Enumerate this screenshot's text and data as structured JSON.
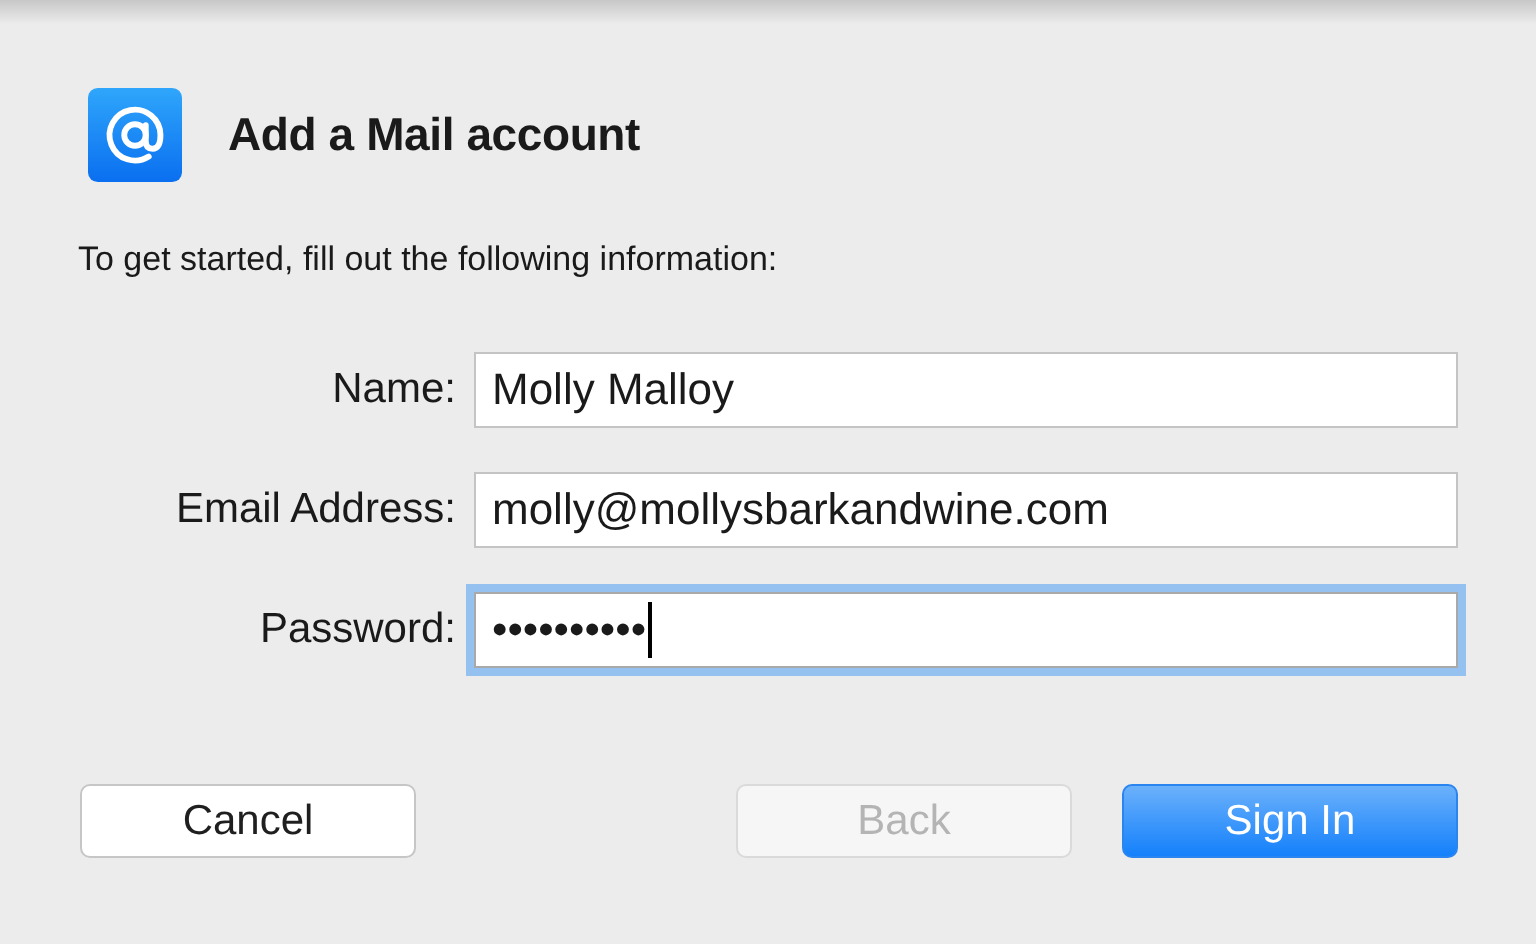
{
  "title": "Add a Mail account",
  "instructions": "To get started, fill out the following information:",
  "fields": [
    {
      "label": "Name:",
      "value": "Molly Malloy",
      "focused": false
    },
    {
      "label": "Email Address:",
      "value": "molly@mollysbarkandwine.com",
      "focused": false
    },
    {
      "label": "Password:",
      "value": "••••••••••",
      "focused": true
    }
  ],
  "buttons": [
    {
      "label": "Cancel",
      "kind": "normal"
    },
    {
      "label": "Back",
      "kind": "disabled"
    },
    {
      "label": "Sign In",
      "kind": "default"
    }
  ]
}
